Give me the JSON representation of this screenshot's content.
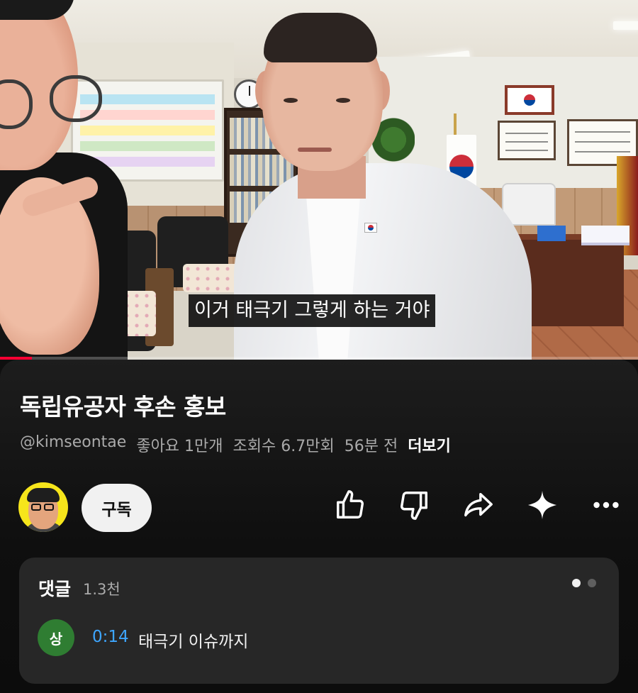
{
  "video": {
    "subtitle": "이거 태극기 그렇게 하는 거야",
    "progress_fraction": 0.05
  },
  "info": {
    "title": "독립유공자 후손 홍보",
    "channel_handle": "@kimseontae",
    "likes": "좋아요 1만개",
    "views": "조회수 6.7만회",
    "time_ago": "56분 전",
    "more_label": "더보기"
  },
  "actions": {
    "subscribe_label": "구독",
    "icons": [
      "thumb-up-icon",
      "thumb-down-icon",
      "share-icon",
      "sparkle-icon",
      "more-icon"
    ]
  },
  "comments": {
    "title": "댓글",
    "count": "1.3천",
    "pager_dots": 2,
    "top_comment": {
      "avatar_letter": "상",
      "avatar_color": "#2f7d32",
      "timestamp": "0:14",
      "text": "태극기 이슈까지"
    }
  },
  "colors": {
    "background": "#0f0f0f",
    "accent_red": "#ff0033",
    "timestamp_blue": "#3ea6ff",
    "secondary_text": "#aaaaaa"
  }
}
